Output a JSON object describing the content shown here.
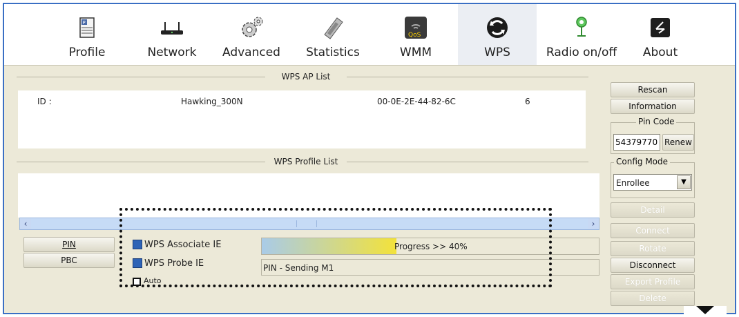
{
  "toolbar": {
    "items": [
      {
        "label": "Profile"
      },
      {
        "label": "Network"
      },
      {
        "label": "Advanced"
      },
      {
        "label": "Statistics"
      },
      {
        "label": "WMM"
      },
      {
        "label": "WPS"
      },
      {
        "label": "Radio on/off"
      },
      {
        "label": "About"
      }
    ],
    "qos_text": "QoS",
    "active_tab": "WPS"
  },
  "ap_list": {
    "title": "WPS AP List",
    "row": {
      "id": "ID :",
      "ssid": "Hawking_300N",
      "bssid": "00-0E-2E-44-82-6C",
      "channel": "6"
    }
  },
  "profile_list": {
    "title": "WPS Profile List"
  },
  "side": {
    "rescan": "Rescan",
    "information": "Information",
    "pin_code_label": "Pin Code",
    "pin_code_value": "54379770",
    "renew": "Renew",
    "config_mode_label": "Config Mode",
    "config_mode_value": "Enrollee",
    "detail": "Detail",
    "connect": "Connect",
    "rotate": "Rotate",
    "disconnect": "Disconnect",
    "export_profile": "Export Profile",
    "delete": "Delete"
  },
  "bottom": {
    "pin_button": "PIN",
    "pbc_button": "PBC",
    "wps_associate_ie": "WPS Associate IE",
    "wps_probe_ie": "WPS Probe IE",
    "auto": "Auto",
    "progress_text": "Progress >> 40%",
    "progress_value": 0.4,
    "status_text": "PIN - Sending M1"
  },
  "colors": {
    "frame_border": "#3a6fc4",
    "panel_bg": "#ece9d8",
    "progress_start": "#a9cbe8",
    "progress_end": "#f3e23a"
  }
}
